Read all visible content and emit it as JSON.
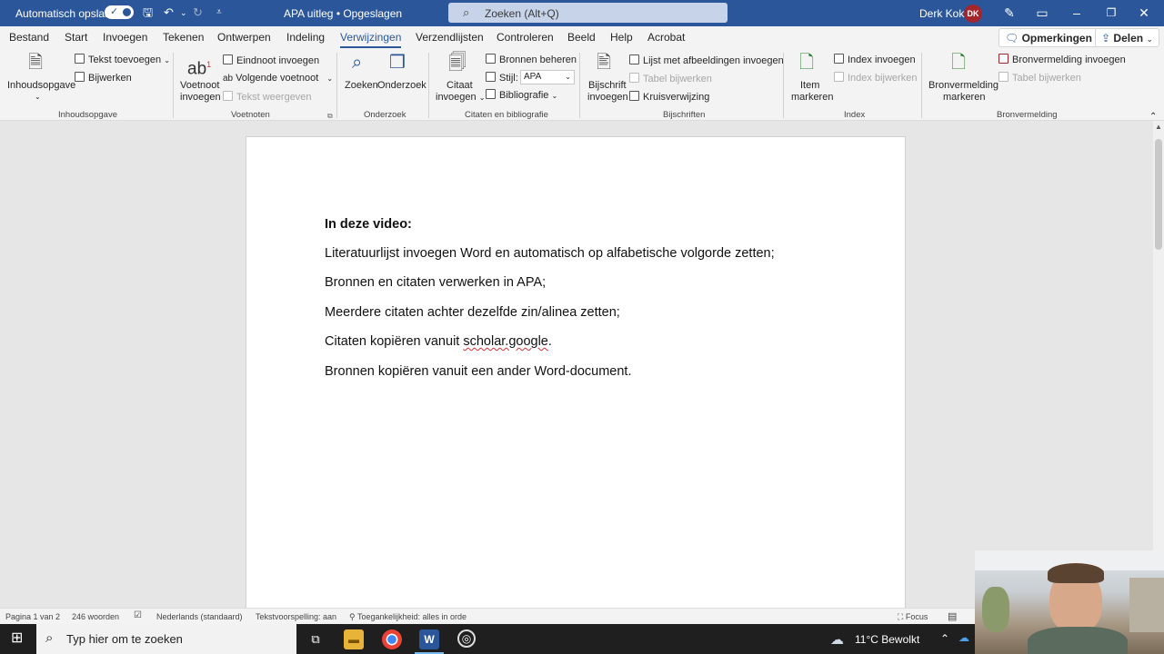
{
  "titlebar": {
    "autosave_label": "Automatisch opslaan",
    "doc_title": "APA uitleg • Opgeslagen",
    "search_placeholder": "Zoeken (Alt+Q)",
    "user_name": "Derk Kok",
    "user_initials": "DK"
  },
  "tabs": [
    "Bestand",
    "Start",
    "Invoegen",
    "Tekenen",
    "Ontwerpen",
    "Indeling",
    "Verwijzingen",
    "Verzendlijsten",
    "Controleren",
    "Beeld",
    "Help",
    "Acrobat"
  ],
  "active_tab": "Verwijzingen",
  "tab_actions": {
    "comments": "Opmerkingen",
    "share": "Delen"
  },
  "ribbon": {
    "toc": {
      "big": "Inhoudsopgave",
      "add_text": "Tekst toevoegen",
      "update": "Bijwerken",
      "group": "Inhoudsopgave"
    },
    "footnotes": {
      "insert_1": "Voetnoot",
      "insert_2": "invoegen",
      "endnote": "Eindnoot invoegen",
      "next": "Volgende voetnoot",
      "show": "Tekst weergeven",
      "group": "Voetnoten"
    },
    "research": {
      "search": "Zoeken",
      "researcher": "Onderzoek",
      "group": "Onderzoek"
    },
    "citations": {
      "insert_1": "Citaat",
      "insert_2": "invoegen",
      "manage": "Bronnen beheren",
      "style_label": "Stijl:",
      "style_value": "APA",
      "bibliography": "Bibliografie",
      "group": "Citaten en bibliografie"
    },
    "captions": {
      "insert_1": "Bijschrift",
      "insert_2": "invoegen",
      "table_figures": "Lijst met afbeeldingen invoegen",
      "update_table": "Tabel bijwerken",
      "cross_ref": "Kruisverwijzing",
      "group": "Bijschriften"
    },
    "index": {
      "mark_1": "Item",
      "mark_2": "markeren",
      "insert": "Index invoegen",
      "update": "Index bijwerken",
      "group": "Index"
    },
    "authorities": {
      "mark_1": "Bronvermelding",
      "mark_2": "markeren",
      "insert": "Bronvermelding invoegen",
      "update": "Tabel bijwerken",
      "group": "Bronvermelding"
    }
  },
  "document": {
    "heading": "In deze video:",
    "lines": [
      "Literatuurlijst invoegen Word en automatisch op alfabetische volgorde zetten;",
      "Bronnen en citaten verwerken in APA;",
      "Meerdere citaten achter dezelfde zin/alinea zetten;"
    ],
    "line4_prefix": "Citaten kopiëren vanuit ",
    "line4_link": "scholar.google",
    "line4_suffix": ".",
    "line5": "Bronnen kopiëren vanuit een ander Word-document."
  },
  "statusbar": {
    "page": "Pagina 1 van 2",
    "words": "246 woorden",
    "language": "Nederlands (standaard)",
    "predictions": "Tekstvoorspelling: aan",
    "accessibility": "Toegankelijkheid: alles in orde",
    "focus": "Focus"
  },
  "taskbar": {
    "search_placeholder": "Typ hier om te zoeken",
    "weather": "11°C  Bewolkt"
  },
  "colors": {
    "word_blue": "#2b579a",
    "avatar": "#a4262c",
    "spell_error": "#d13438"
  }
}
